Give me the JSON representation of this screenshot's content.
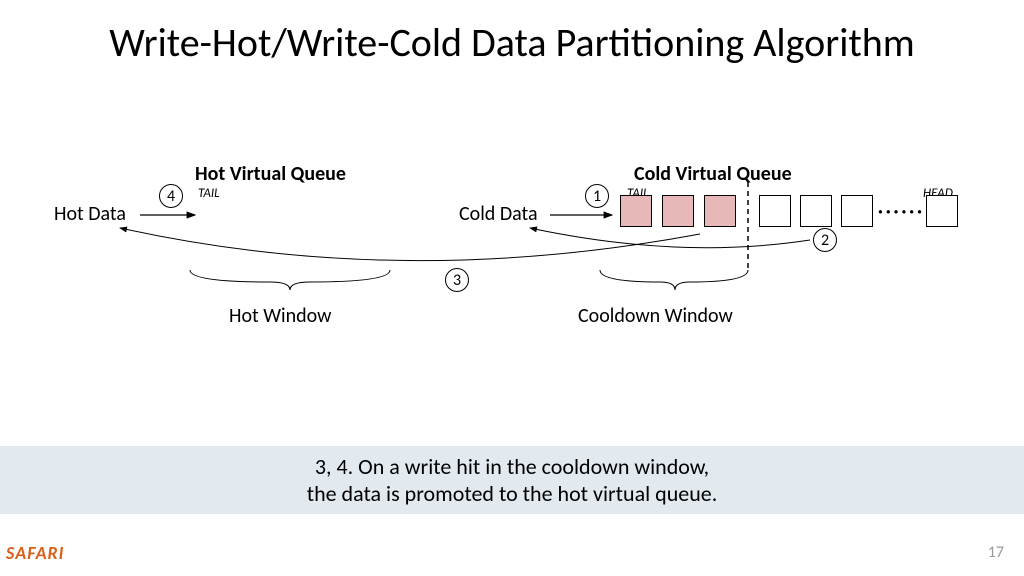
{
  "title": "Write-Hot/Write-Cold Data Partitioning Algorithm",
  "hot_queue_title": "Hot Virtual Queue",
  "cold_queue_title": "Cold Virtual Queue",
  "hot_data_label": "Hot Data",
  "cold_data_label": "Cold Data",
  "tail_label": "TAIL",
  "head_label": "HEAD",
  "num1": "1",
  "num2": "2",
  "num3": "3",
  "num4": "4",
  "hot_window_label": "Hot Window",
  "cooldown_window_label": "Cooldown Window",
  "caption_line1": "3, 4. On a write hit in the cooldown window,",
  "caption_line2": "the data is promoted to the hot virtual queue.",
  "footer_logo": "SAFARI",
  "page_number": "17",
  "dots": "······"
}
